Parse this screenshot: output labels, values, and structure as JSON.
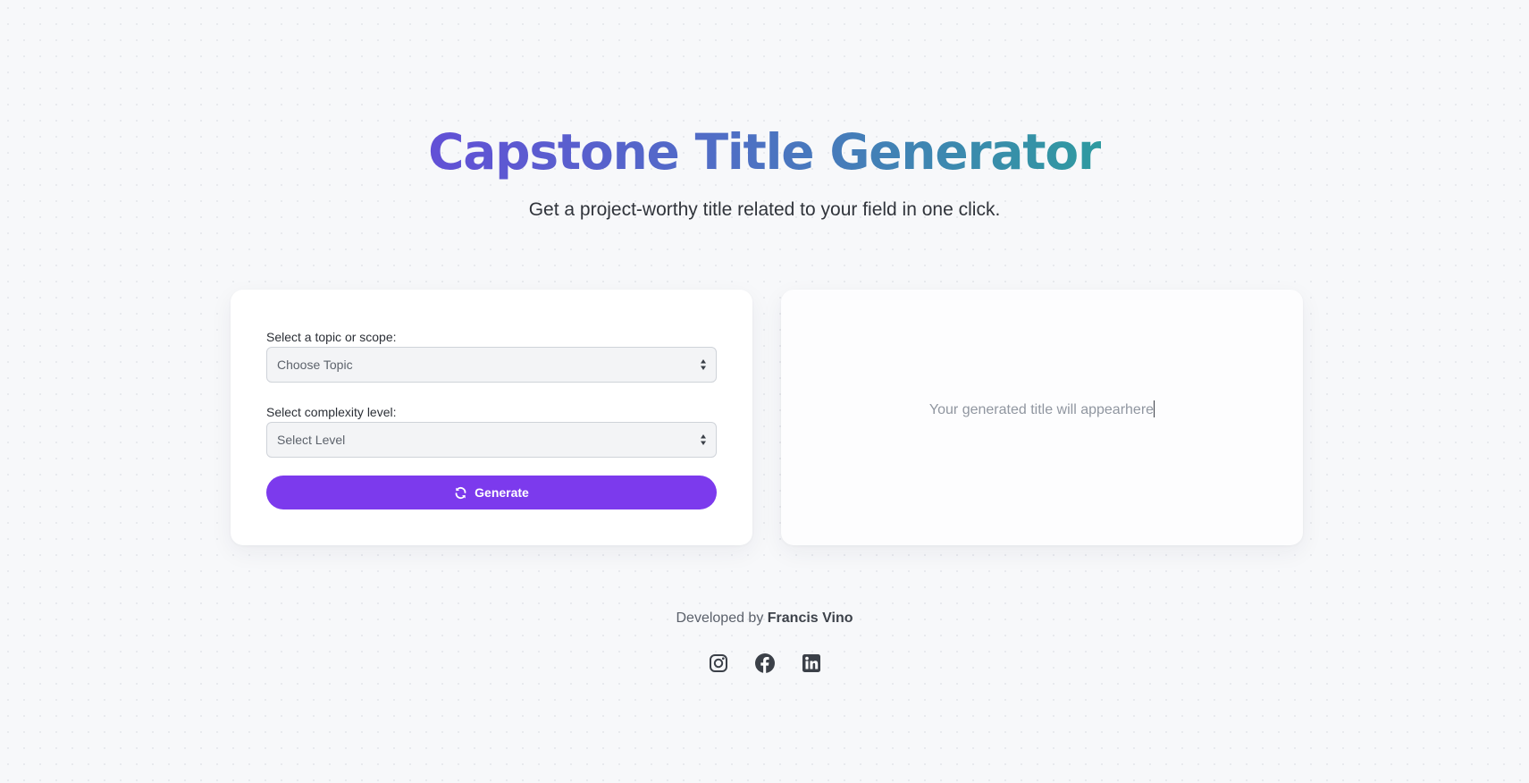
{
  "header": {
    "title": "Capstone Title Generator",
    "subtitle": "Get a project-worthy title related to your field in one click."
  },
  "form": {
    "topic_label": "Select a topic or scope:",
    "topic_value": "Choose Topic",
    "level_label": "Select complexity level:",
    "level_value": "Select Level",
    "generate_label": "Generate",
    "generate_icon": "refresh-icon",
    "accent_color": "#7c3aed"
  },
  "output": {
    "placeholder": "Your generated title will appearhere"
  },
  "footer": {
    "prefix": "Developed by",
    "author": "Francis Vino",
    "socials": [
      {
        "icon": "instagram-icon"
      },
      {
        "icon": "facebook-icon"
      },
      {
        "icon": "linkedin-icon"
      }
    ]
  }
}
